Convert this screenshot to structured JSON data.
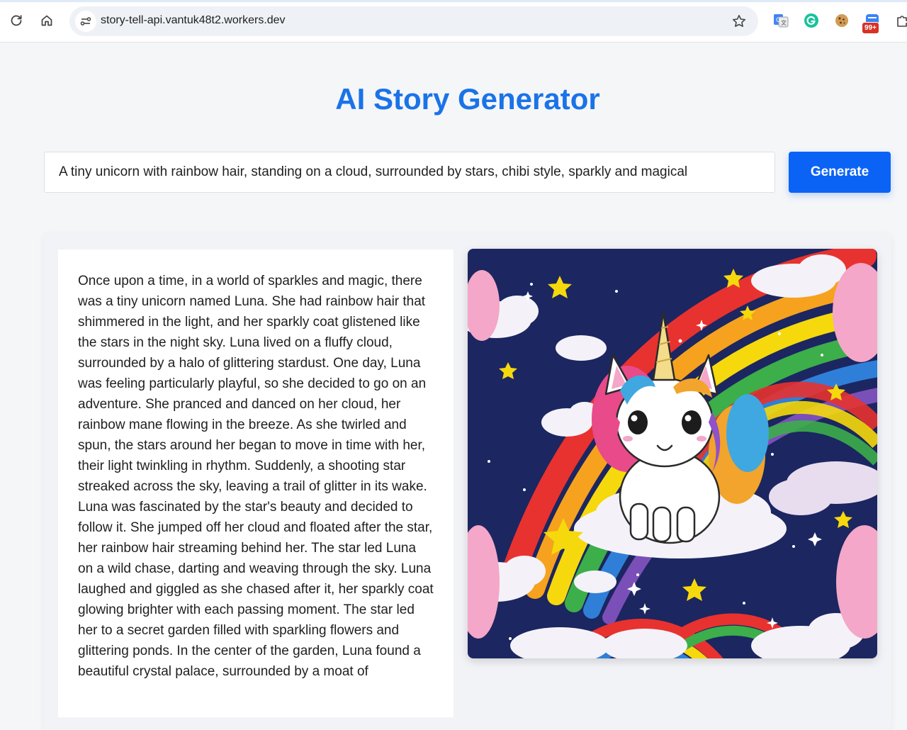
{
  "browser": {
    "url": "story-tell-api.vantuk48t2.workers.dev",
    "notification_badge": "99+"
  },
  "page": {
    "title": "AI Story Generator",
    "prompt_value": "A tiny unicorn with rainbow hair, standing on a cloud, surrounded by stars, chibi style, sparkly and magical",
    "generate_label": "Generate",
    "story_text": "Once upon a time, in a world of sparkles and magic, there was a tiny unicorn named Luna. She had rainbow hair that shimmered in the light, and her sparkly coat glistened like the stars in the night sky. Luna lived on a fluffy cloud, surrounded by a halo of glittering stardust. One day, Luna was feeling particularly playful, so she decided to go on an adventure. She pranced and danced on her cloud, her rainbow mane flowing in the breeze. As she twirled and spun, the stars around her began to move in time with her, their light twinkling in rhythm. Suddenly, a shooting star streaked across the sky, leaving a trail of glitter in its wake. Luna was fascinated by the star's beauty and decided to follow it. She jumped off her cloud and floated after the star, her rainbow hair streaming behind her. The star led Luna on a wild chase, darting and weaving through the sky. Luna laughed and giggled as she chased after it, her sparkly coat glowing brighter with each passing moment. The star led her to a secret garden filled with sparkling flowers and glittering ponds. In the center of the garden, Luna found a beautiful crystal palace, surrounded by a moat of"
  },
  "colors": {
    "title": "#1a73e8",
    "button": "#0b63f6",
    "sky": "#1c2660"
  },
  "icons": [
    "reload-icon",
    "home-icon",
    "site-info-icon",
    "bookmark-star-icon",
    "translate-extension-icon",
    "grammarly-extension-icon",
    "cookie-extension-icon",
    "notifications-extension-icon",
    "extensions-puzzle-icon"
  ]
}
